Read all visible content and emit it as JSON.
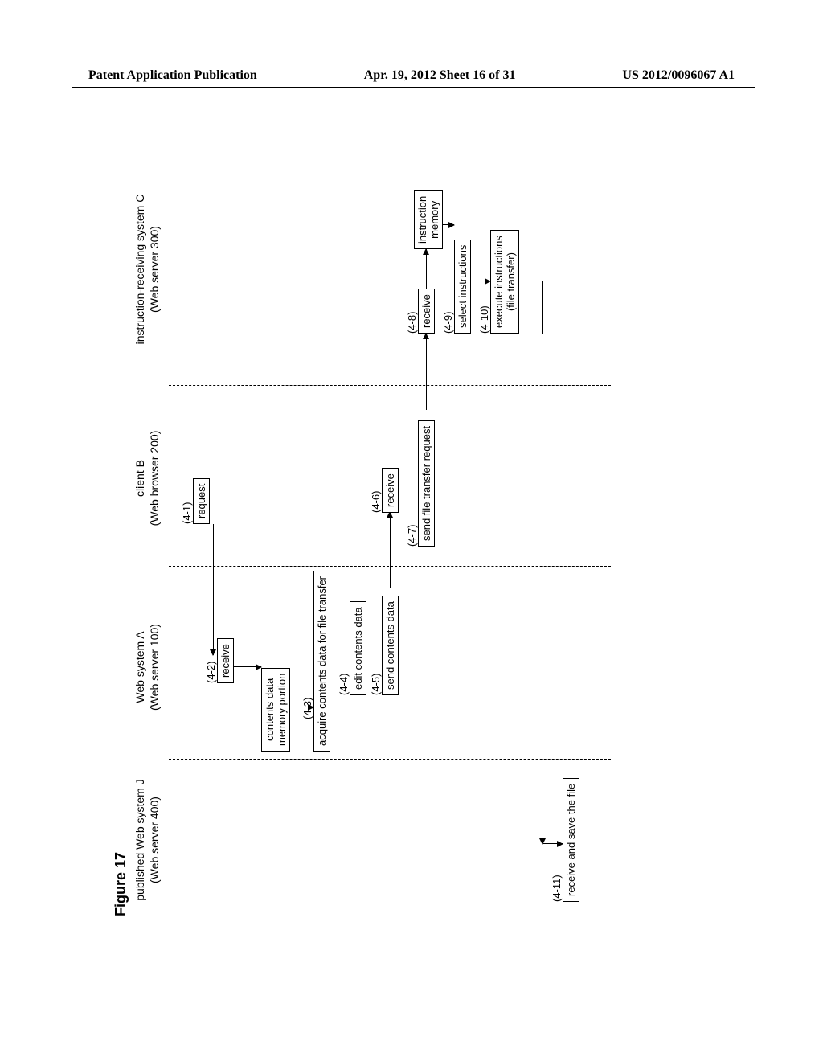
{
  "header": {
    "left": "Patent Application Publication",
    "center": "Apr. 19, 2012  Sheet 16 of 31",
    "right": "US 2012/0096067 A1"
  },
  "figure_label": "Figure 17",
  "lanes": {
    "j": {
      "title": "published Web system J",
      "subtitle": "(Web server 400)"
    },
    "a": {
      "title": "Web system A",
      "subtitle": "(Web server 100)"
    },
    "b": {
      "title": "client B",
      "subtitle": "(Web browser 200)"
    },
    "c": {
      "title": "instruction-receiving system C",
      "subtitle": "(Web server 300)"
    }
  },
  "steps": {
    "s4_1": {
      "num": "(4-1)",
      "label": "request"
    },
    "s4_2": {
      "num": "(4-2)",
      "label": "receive"
    },
    "mem_a": "contents data\nmemory portion",
    "s4_3": {
      "num": "(4-3)",
      "label": "acquire contents data for file transfer"
    },
    "s4_4": {
      "num": "(4-4)",
      "label": "edit contents data"
    },
    "s4_5": {
      "num": "(4-5)",
      "label": "send contents data"
    },
    "s4_6": {
      "num": "(4-6)",
      "label": "receive"
    },
    "s4_7": {
      "num": "(4-7)",
      "label": "send file transfer request"
    },
    "s4_8": {
      "num": "(4-8)",
      "label": "receive"
    },
    "mem_c": "instruction\nmemory",
    "s4_9": {
      "num": "(4-9)",
      "label": "select instructions"
    },
    "s4_10": {
      "num": "(4-10)",
      "label": "execute instructions\n(file transfer)"
    },
    "s4_11": {
      "num": "(4-11)",
      "label": "receive and save the file"
    }
  }
}
